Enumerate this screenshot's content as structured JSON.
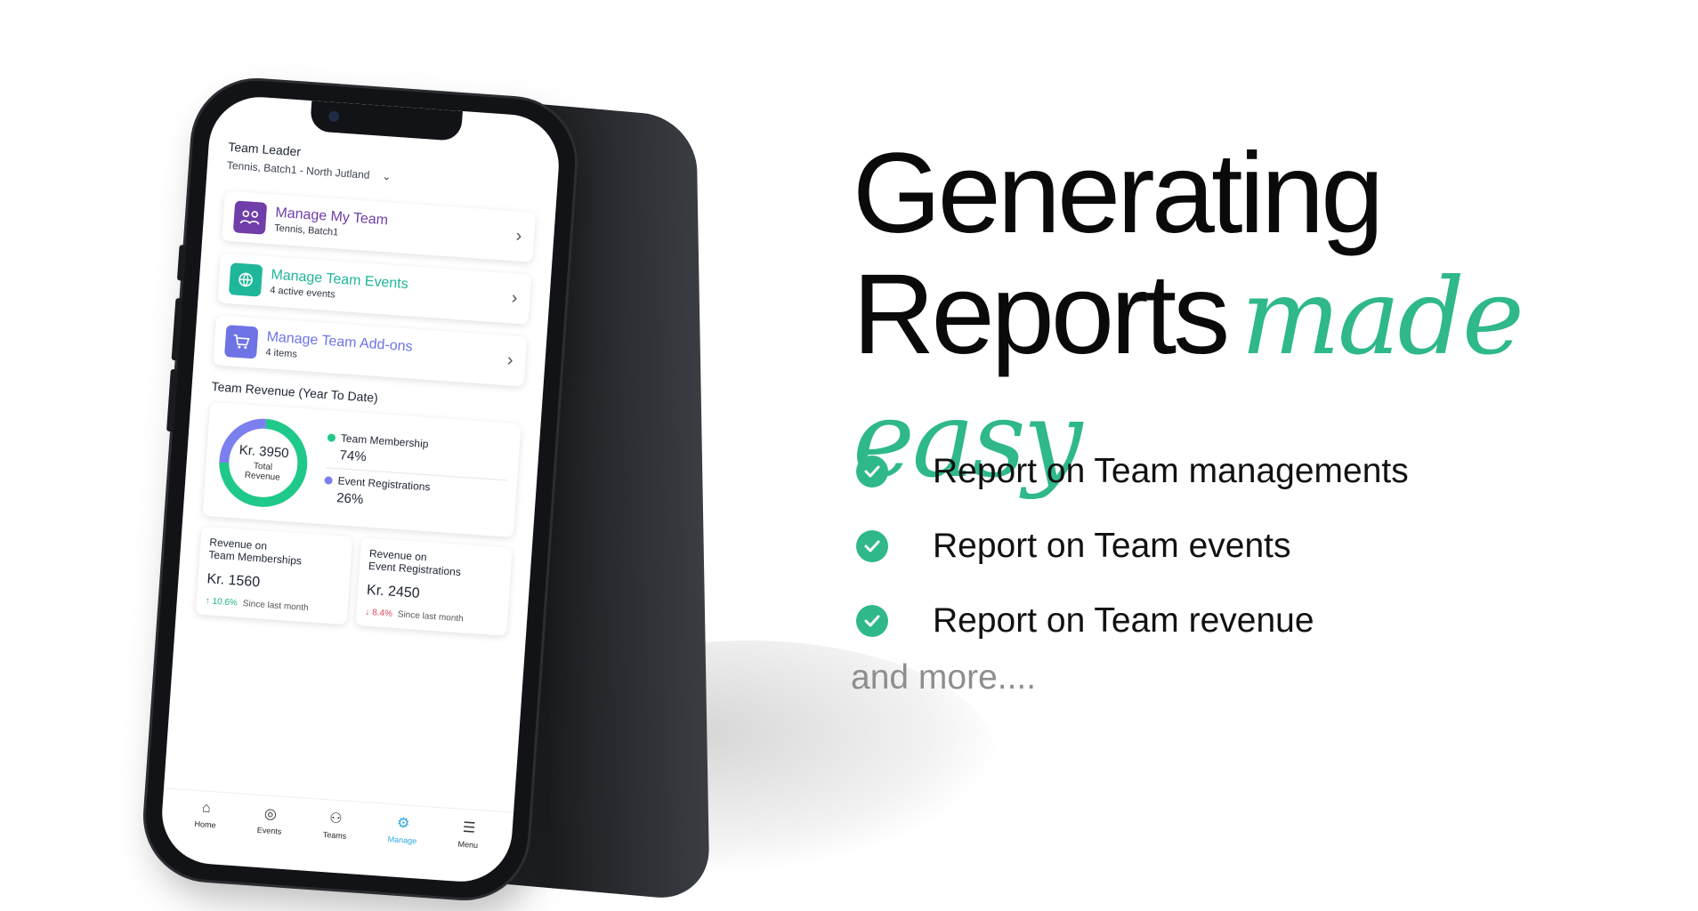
{
  "colors": {
    "accent_green": "#2fb88a",
    "purple": "#6f3ea8",
    "teal": "#1fb79a",
    "violet": "#6e74e6",
    "down_red": "#e0445a",
    "up_green": "#1bb57f"
  },
  "app": {
    "role": "Team Leader",
    "team_selector": "Tennis, Batch1 - North Jutland",
    "menu": [
      {
        "title": "Manage My Team",
        "subtitle": "Tennis, Batch1",
        "icon": "team-icon"
      },
      {
        "title": "Manage Team Events",
        "subtitle": "4 active events",
        "icon": "events-icon"
      },
      {
        "title": "Manage Team Add-ons",
        "subtitle": "4 items",
        "icon": "cart-icon"
      }
    ],
    "revenue_section": "Team Revenue (Year To Date)",
    "donut": {
      "amount": "Kr. 3950",
      "label_line1": "Total",
      "label_line2": "Revenue"
    },
    "legend": [
      {
        "name": "Team Membership",
        "pct": "74%"
      },
      {
        "name": "Event Registrations",
        "pct": "26%"
      }
    ],
    "stats": [
      {
        "title_line1": "Revenue on",
        "title_line2": "Team Memberships",
        "amount": "Kr. 1560",
        "change": "↑ 10.6%",
        "since": "Since last month"
      },
      {
        "title_line1": "Revenue on",
        "title_line2": "Event Registrations",
        "amount": "Kr. 2450",
        "change": "↓ 8.4%",
        "since": "Since last month"
      }
    ],
    "tabs": [
      {
        "label": "Home",
        "icon": "home-icon"
      },
      {
        "label": "Events",
        "icon": "globe-icon"
      },
      {
        "label": "Teams",
        "icon": "teams-icon"
      },
      {
        "label": "Manage",
        "icon": "manage-icon",
        "active": true
      },
      {
        "label": "Menu",
        "icon": "menu-icon"
      }
    ]
  },
  "chart_data": {
    "type": "pie",
    "categories": [
      "Team Membership",
      "Event Registrations"
    ],
    "values": [
      74,
      26
    ]
  },
  "marketing": {
    "headline_line1": "Generating",
    "headline_line2": "Reports",
    "headline_accent": "made easy",
    "bullets": [
      "Report on Team managements",
      "Report on Team events",
      "Report on Team revenue"
    ],
    "more": "and more...."
  }
}
